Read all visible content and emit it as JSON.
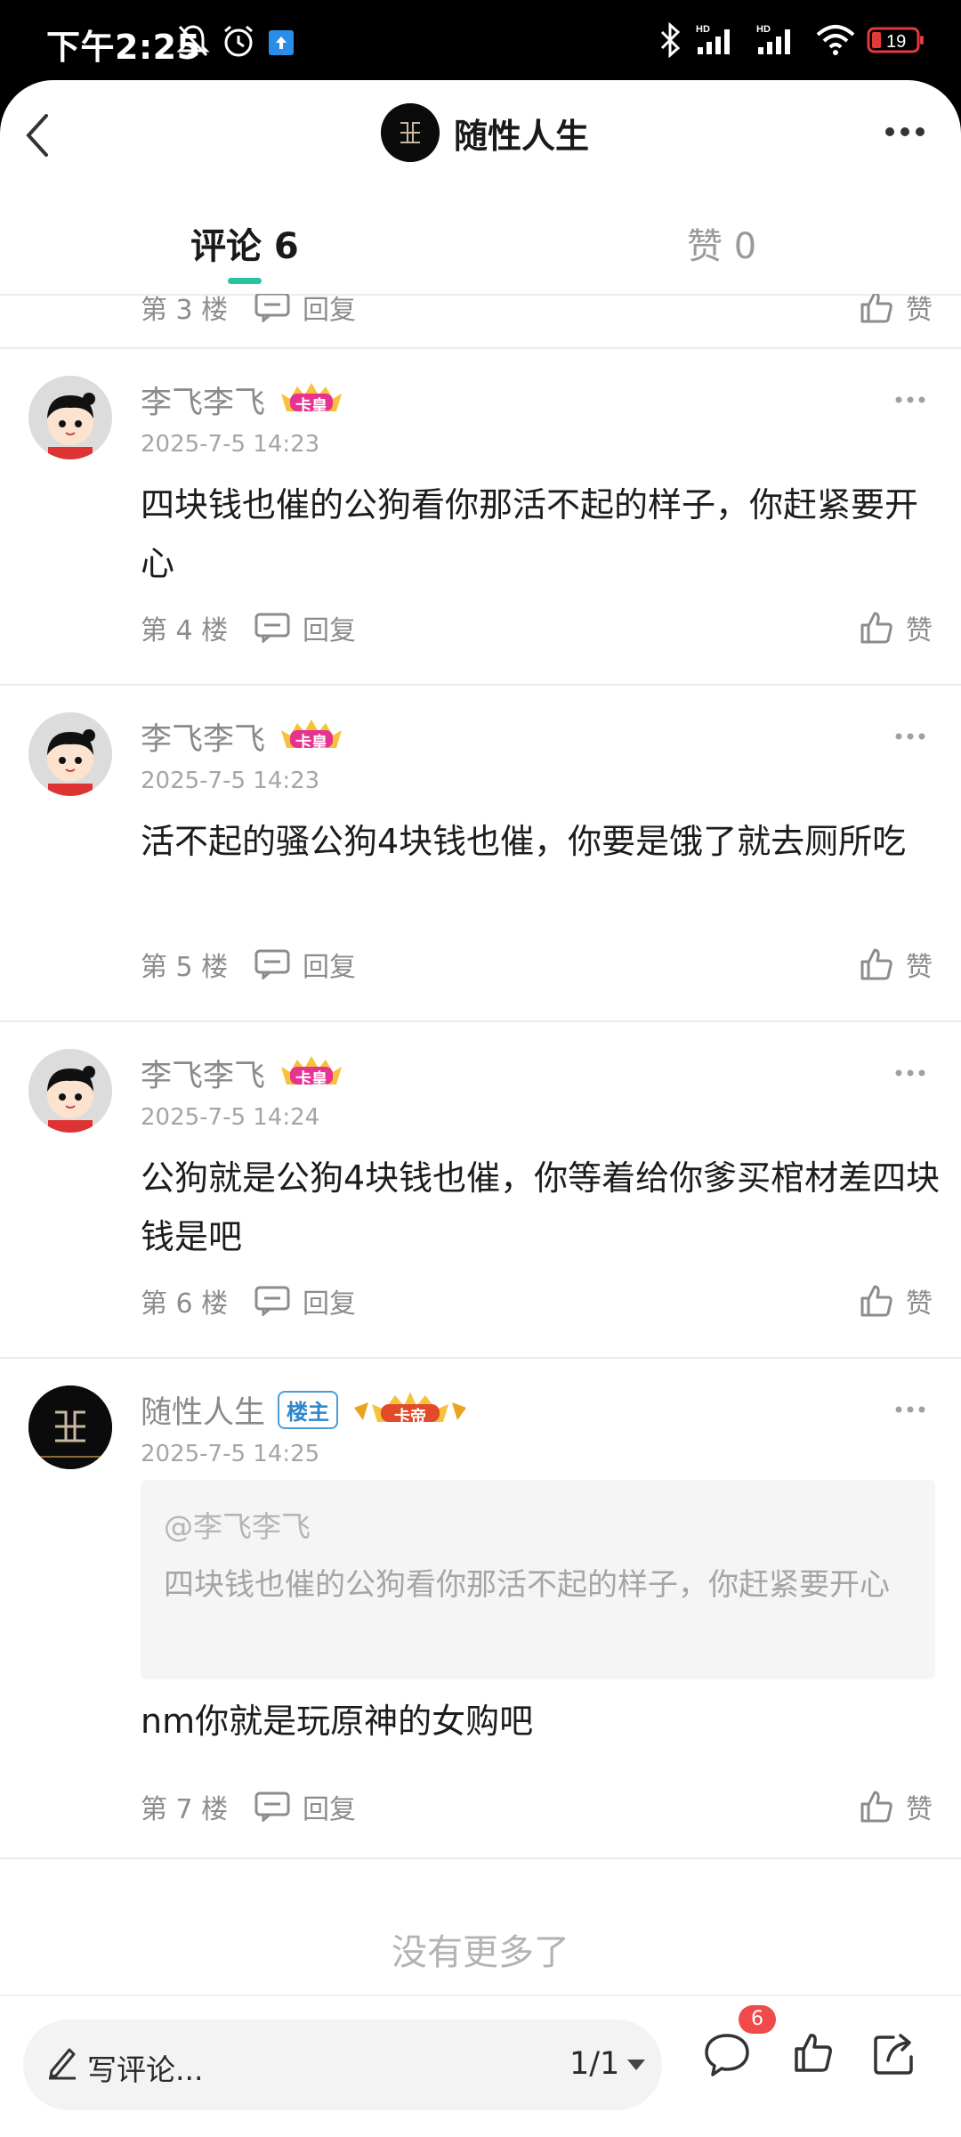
{
  "status_bar": {
    "time": "下午2:25",
    "battery": "19"
  },
  "header": {
    "title": "随性人生"
  },
  "tabs": [
    {
      "label": "评论 6",
      "active": true
    },
    {
      "label": "赞 0",
      "active": false
    }
  ],
  "partial_row": {
    "floor": "第 3 楼",
    "reply": "回复",
    "like": "赞"
  },
  "comments": [
    {
      "name": "李飞李飞",
      "badge": "卡皇",
      "time": "2025-7-5 14:23",
      "text": "四块钱也催的公狗看你那活不起的样子，你赶紧要开心",
      "floor": "第 4 楼",
      "reply": "回复",
      "like": "赞"
    },
    {
      "name": "李飞李飞",
      "badge": "卡皇",
      "time": "2025-7-5 14:23",
      "text": "活不起的骚公狗4块钱也催，你要是饿了就去厕所吃",
      "floor": "第 5 楼",
      "reply": "回复",
      "like": "赞"
    },
    {
      "name": "李飞李飞",
      "badge": "卡皇",
      "time": "2025-7-5 14:24",
      "text": "公狗就是公狗4块钱也催，你等着给你爹买棺材差四块钱是吧",
      "floor": "第 6 楼",
      "reply": "回复",
      "like": "赞"
    },
    {
      "name": "随性人生",
      "host_badge": "楼主",
      "badge": "卡帝",
      "time": "2025-7-5 14:25",
      "quote_user": "@李飞李飞",
      "quote_text": "四块钱也催的公狗看你那活不起的样子，你赶紧要开心",
      "text": "nm你就是玩原神的女购吧",
      "floor": "第 7 楼",
      "reply": "回复",
      "like": "赞"
    }
  ],
  "footer_text": "没有更多了",
  "bottom_bar": {
    "input_placeholder": "写评论...",
    "page_indicator": "1/1",
    "comment_count": "6"
  },
  "colors": {
    "accent": "#27c2a0",
    "badge_red": "#f04a4a",
    "host_badge_blue": "#2f86c9"
  }
}
